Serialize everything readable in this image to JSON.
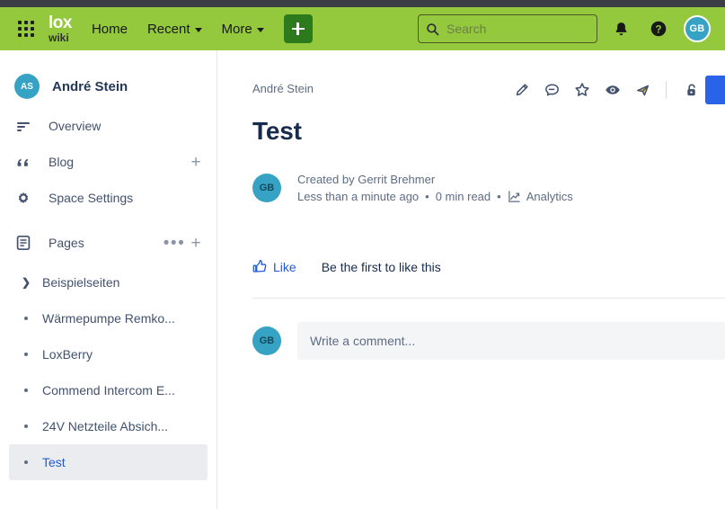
{
  "navbar": {
    "app_switcher_icon": "grid-apps-icon",
    "logo_primary": "lox",
    "logo_secondary": "wiki",
    "links": [
      {
        "label": "Home",
        "has_caret": false
      },
      {
        "label": "Recent",
        "has_caret": true
      },
      {
        "label": "More",
        "has_caret": true
      }
    ],
    "create_button_label": "+",
    "search": {
      "placeholder": "Search",
      "value": "",
      "icon": "search-icon"
    },
    "notifications_icon": "bell-icon",
    "help_icon": "question-circle-icon",
    "profile_initials": "GB"
  },
  "sidebar": {
    "space": {
      "initials": "AS",
      "name": "André Stein"
    },
    "items": [
      {
        "label": "Overview",
        "icon": "overview-lines-icon",
        "action": ""
      },
      {
        "label": "Blog",
        "icon": "quote-icon",
        "action": "+"
      },
      {
        "label": "Space Settings",
        "icon": "gear-icon",
        "action": ""
      },
      {
        "label": "Pages",
        "icon": "pages-document-icon",
        "action": "+",
        "more": "•••"
      }
    ],
    "tree": [
      {
        "label": "Beispielseiten",
        "marker": "chevron",
        "selected": false
      },
      {
        "label": "Wärmepumpe Remko...",
        "marker": "bullet",
        "selected": false
      },
      {
        "label": "LoxBerry",
        "marker": "bullet",
        "selected": false
      },
      {
        "label": "Commend Intercom E...",
        "marker": "bullet",
        "selected": false
      },
      {
        "label": "24V Netzteile Absich...",
        "marker": "bullet",
        "selected": false
      },
      {
        "label": "Test",
        "marker": "bullet",
        "selected": true
      }
    ]
  },
  "content": {
    "breadcrumb": "André Stein",
    "title": "Test",
    "actions": [
      {
        "icon": "edit-pencil-icon",
        "name": "edit-page-button"
      },
      {
        "icon": "comment-icon",
        "name": "comment-button"
      },
      {
        "icon": "star-icon",
        "name": "favourite-button"
      },
      {
        "icon": "eye-watch-icon",
        "name": "watch-button"
      },
      {
        "icon": "share-icon",
        "name": "share-button"
      },
      {
        "icon": "unlock-restrictions-icon",
        "name": "restrictions-button"
      }
    ],
    "byline": {
      "avatar_initials": "GB",
      "created_prefix": "Created by",
      "author": "Gerrit Brehmer",
      "time_ago": "Less than a minute ago",
      "separator": "•",
      "read_time": "0 min read",
      "analytics_label": "Analytics",
      "analytics_icon": "analytics-chart-icon"
    },
    "likes": {
      "like_label": "Like",
      "like_icon": "thumbs-up-icon",
      "count_text": "Be the first to like this"
    },
    "comment": {
      "avatar_initials": "GB",
      "placeholder": "Write a comment...",
      "value": ""
    }
  },
  "colors": {
    "navbar_green": "#95c93d",
    "create_green": "#2d7a1d",
    "top_strip": "#3b3f45",
    "avatar_teal": "#37a3c4",
    "link_blue": "#2159d8",
    "button_blue": "#2a62e8",
    "text_dark": "#172b4d",
    "text_muted": "#5e6c84"
  }
}
